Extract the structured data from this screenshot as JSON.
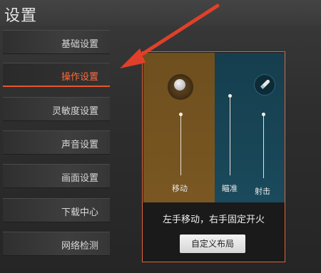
{
  "header": {
    "title": "设置"
  },
  "sidebar": {
    "items": [
      {
        "label": "基础设置",
        "active": false
      },
      {
        "label": "操作设置",
        "active": true
      },
      {
        "label": "灵敏度设置",
        "active": false
      },
      {
        "label": "声音设置",
        "active": false
      },
      {
        "label": "画面设置",
        "active": false
      },
      {
        "label": "下载中心",
        "active": false
      },
      {
        "label": "网络检测",
        "active": false
      }
    ]
  },
  "panel": {
    "move_label": "移动",
    "aim_label": "瞄准",
    "fire_label": "射击",
    "hint": "左手移动，右手固定开火",
    "custom_button": "自定义布局"
  },
  "colors": {
    "accent": "#e8562a",
    "move_zone": "#7a5722",
    "aim_zone": "#1a4a5c",
    "arrow": "#e0402a"
  }
}
